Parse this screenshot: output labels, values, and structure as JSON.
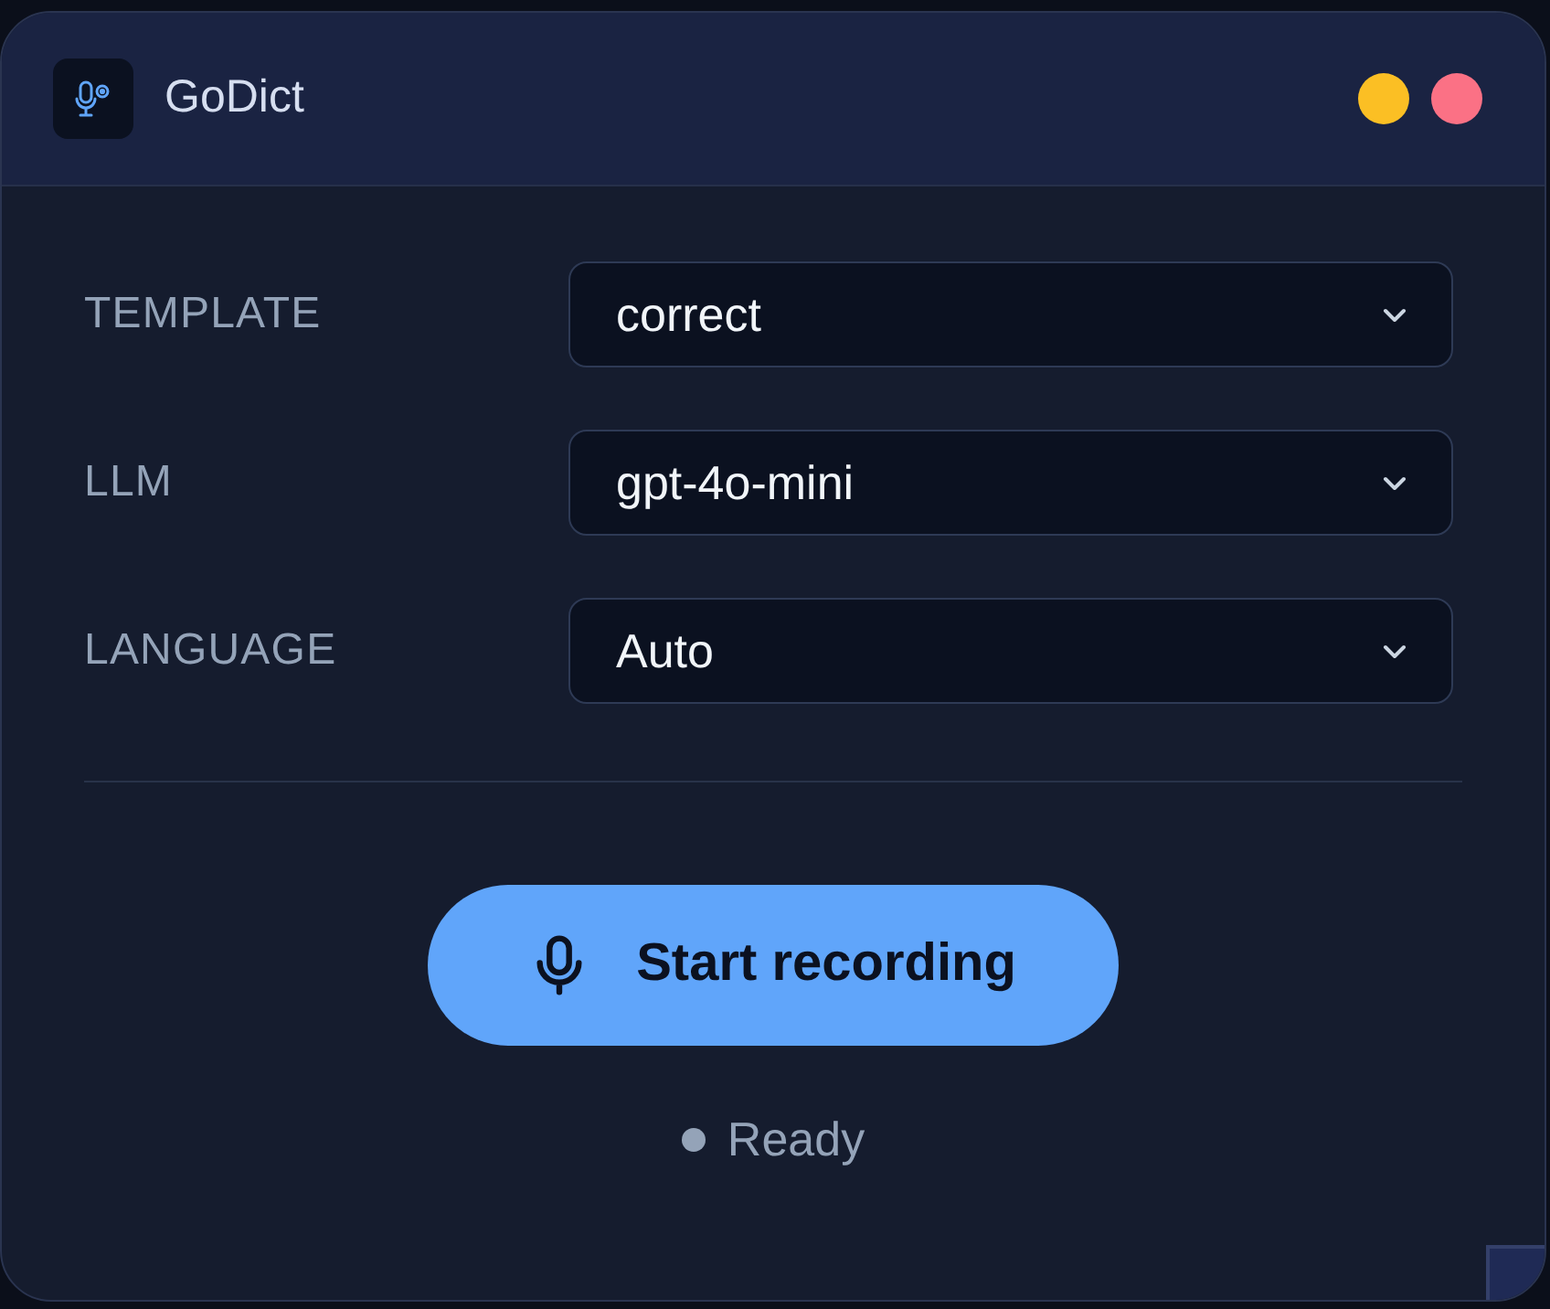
{
  "window": {
    "title": "GoDict"
  },
  "settings": [
    {
      "label": "TEMPLATE",
      "value": "correct"
    },
    {
      "label": "LLM",
      "value": "gpt-4o-mini"
    },
    {
      "label": "LANGUAGE",
      "value": "Auto"
    }
  ],
  "record_button": {
    "label": "Start recording"
  },
  "status": {
    "text": "Ready"
  }
}
